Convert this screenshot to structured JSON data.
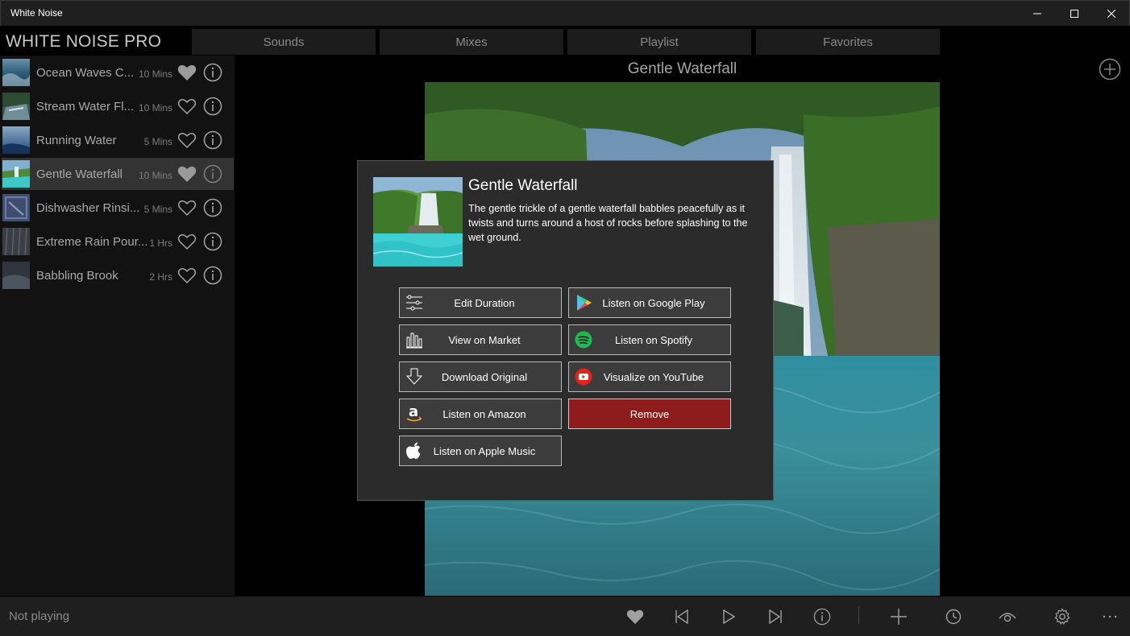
{
  "window": {
    "title": "White Noise"
  },
  "app": {
    "brand": "WHITE NOISE PRO"
  },
  "tabs": [
    {
      "label": "Sounds"
    },
    {
      "label": "Mixes"
    },
    {
      "label": "Playlist"
    },
    {
      "label": "Favorites"
    }
  ],
  "playlist": [
    {
      "name": "Ocean Waves C...",
      "duration": "10 Mins",
      "favorite": true
    },
    {
      "name": "Stream Water Fl...",
      "duration": "10 Mins",
      "favorite": false
    },
    {
      "name": "Running Water",
      "duration": "5 Mins",
      "favorite": false
    },
    {
      "name": "Gentle Waterfall",
      "duration": "10 Mins",
      "favorite": true,
      "selected": true
    },
    {
      "name": "Dishwasher Rinsi...",
      "duration": "5 Mins",
      "favorite": false
    },
    {
      "name": "Extreme Rain Pour...",
      "duration": "1 Hrs",
      "favorite": false
    },
    {
      "name": "Babbling Brook",
      "duration": "2 Hrs",
      "favorite": false
    }
  ],
  "main": {
    "title": "Gentle Waterfall"
  },
  "dialog": {
    "title": "Gentle Waterfall",
    "description": "The gentle trickle of a gentle waterfall babbles peacefully as it twists and turns around a host of rocks before splashing to the wet ground.",
    "buttons": {
      "edit_duration": "Edit Duration",
      "view_market": "View on Market",
      "download_original": "Download Original",
      "listen_amazon": "Listen on Amazon",
      "listen_apple": "Listen on Apple Music",
      "listen_google": "Listen on Google Play",
      "listen_spotify": "Listen on Spotify",
      "visualize_youtube": "Visualize on YouTube",
      "remove": "Remove"
    }
  },
  "status": {
    "text": "Not playing"
  },
  "colors": {
    "remove": "#8f1c1c",
    "spotify": "#1db954",
    "youtube": "#e62117",
    "selected_row": "#333333"
  }
}
